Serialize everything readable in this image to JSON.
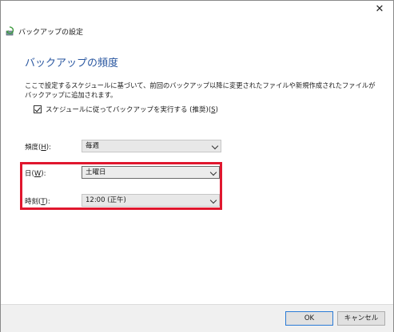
{
  "window": {
    "title": "バックアップの設定",
    "close_glyph": "✕"
  },
  "heading": "バックアップの頻度",
  "description": "ここで設定するスケジュールに基づいて、前回のバックアップ以降に変更されたファイルや新規作成されたファイルがバックアップに追加されます。",
  "schedule_checkbox": {
    "label": "スケジュールに従ってバックアップを実行する (推奨)",
    "access_key": "S",
    "checked": true
  },
  "frequency": {
    "label": "頻度",
    "access_key": "H",
    "value": "毎週"
  },
  "day": {
    "label": "日",
    "access_key": "W",
    "value": "土曜日"
  },
  "time": {
    "label": "時刻",
    "access_key": "T",
    "value": "12:00 (正午)"
  },
  "buttons": {
    "ok": "OK",
    "cancel": "キャンセル"
  },
  "colors": {
    "heading": "#2a57a0",
    "highlight": "#e0172e"
  }
}
